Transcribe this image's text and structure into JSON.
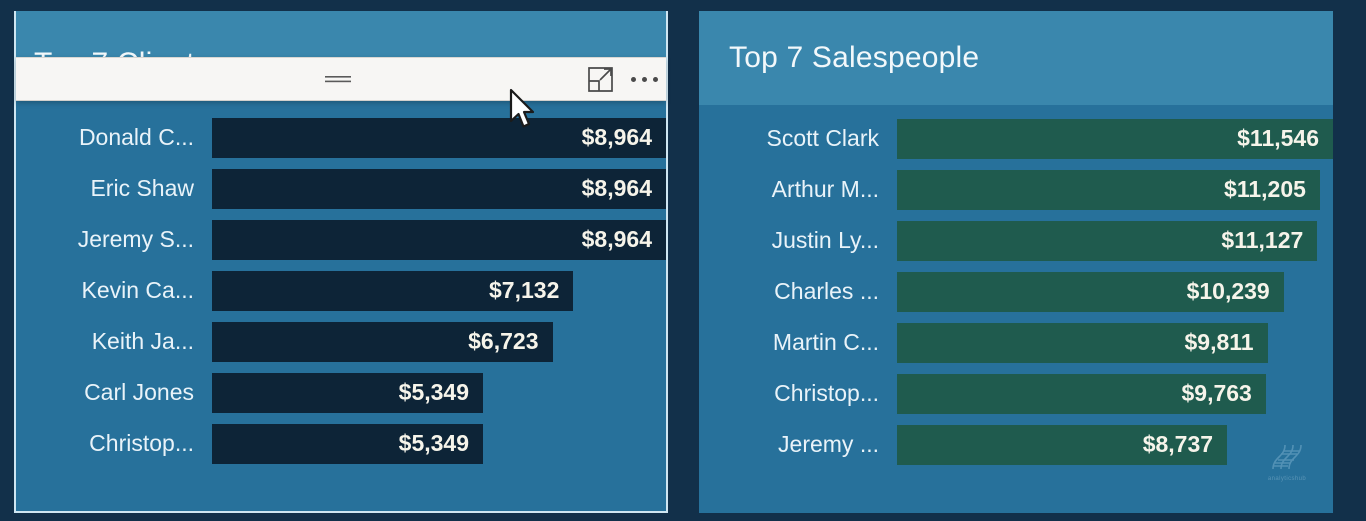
{
  "background": {
    "color": "#12304a"
  },
  "clients_panel": {
    "title": "Top 7 Clients",
    "bar_color": "#0d2437",
    "header_color": "#3a87ad",
    "body_color": "#27719b",
    "selected_border": "#cfe6f2",
    "rows": [
      {
        "label": "Donald C...",
        "value": "$8,964",
        "amount": 8964,
        "width_pct": 100.0
      },
      {
        "label": "Eric Shaw",
        "value": "$8,964",
        "amount": 8964,
        "width_pct": 100.0
      },
      {
        "label": "Jeremy S...",
        "value": "$8,964",
        "amount": 8964,
        "width_pct": 100.0
      },
      {
        "label": "Kevin Ca...",
        "value": "$7,132",
        "amount": 7132,
        "width_pct": 79.6
      },
      {
        "label": "Keith Ja...",
        "value": "$6,723",
        "amount": 6723,
        "width_pct": 75.0
      },
      {
        "label": "Carl Jones",
        "value": "$5,349",
        "amount": 5349,
        "width_pct": 59.7
      },
      {
        "label": "Christop...",
        "value": "$5,349",
        "amount": 5349,
        "width_pct": 59.7
      }
    ]
  },
  "sales_panel": {
    "title": "Top 7 Salespeople",
    "bar_color": "#1f5b4e",
    "header_color": "#3a87ad",
    "body_color": "#27719b",
    "rows": [
      {
        "label": "Scott Clark",
        "value": "$11,546",
        "amount": 11546,
        "width_pct": 100.0
      },
      {
        "label": "Arthur M...",
        "value": "$11,205",
        "amount": 11205,
        "width_pct": 97.0
      },
      {
        "label": "Justin Ly...",
        "value": "$11,127",
        "amount": 11127,
        "width_pct": 96.4
      },
      {
        "label": "Charles ...",
        "value": "$10,239",
        "amount": 10239,
        "width_pct": 88.7
      },
      {
        "label": "Martin C...",
        "value": "$9,811",
        "amount": 9811,
        "width_pct": 85.0
      },
      {
        "label": "Christop...",
        "value": "$9,763",
        "amount": 9763,
        "width_pct": 84.6
      },
      {
        "label": "Jeremy ...",
        "value": "$8,737",
        "amount": 8737,
        "width_pct": 75.7
      }
    ]
  },
  "visual_toolbar": {
    "drag_handle": "drag-handle",
    "focus_mode_label": "Focus mode",
    "more_options_label": "More options"
  },
  "watermark": {
    "text": "analyticshub"
  },
  "chart_data": [
    {
      "type": "bar",
      "title": "Top 7 Clients",
      "orientation": "horizontal",
      "categories": [
        "Donald C...",
        "Eric Shaw",
        "Jeremy S...",
        "Kevin Ca...",
        "Keith Ja...",
        "Carl Jones",
        "Christop..."
      ],
      "values": [
        8964,
        8964,
        8964,
        7132,
        6723,
        5349,
        5349
      ],
      "value_labels": [
        "$8,964",
        "$8,964",
        "$8,964",
        "$7,132",
        "$6,723",
        "$5,349",
        "$5,349"
      ],
      "xlabel": "",
      "ylabel": "",
      "xlim": [
        0,
        8964
      ],
      "grid": false,
      "legend": false,
      "series_color": "#0d2437"
    },
    {
      "type": "bar",
      "title": "Top 7 Salespeople",
      "orientation": "horizontal",
      "categories": [
        "Scott Clark",
        "Arthur M...",
        "Justin Ly...",
        "Charles ...",
        "Martin C...",
        "Christop...",
        "Jeremy ..."
      ],
      "values": [
        11546,
        11205,
        11127,
        10239,
        9811,
        9763,
        8737
      ],
      "value_labels": [
        "$11,546",
        "$11,205",
        "$11,127",
        "$10,239",
        "$9,811",
        "$9,763",
        "$8,737"
      ],
      "xlabel": "",
      "ylabel": "",
      "xlim": [
        0,
        11546
      ],
      "grid": false,
      "legend": false,
      "series_color": "#1f5b4e"
    }
  ]
}
